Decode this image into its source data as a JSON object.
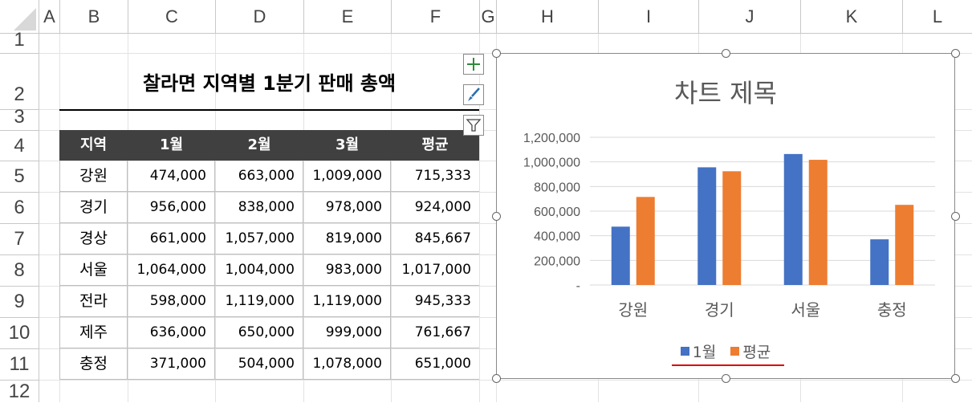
{
  "columns": [
    "A",
    "B",
    "C",
    "D",
    "E",
    "F",
    "G",
    "H",
    "I",
    "J",
    "K",
    "L"
  ],
  "rows": [
    "1",
    "2",
    "3",
    "4",
    "5",
    "6",
    "7",
    "8",
    "9",
    "10",
    "11",
    "12"
  ],
  "table": {
    "title": "찰라면 지역별 1분기 판매 총액",
    "headers": [
      "지역",
      "1월",
      "2월",
      "3월",
      "평균"
    ],
    "body": [
      [
        "강원",
        "474,000",
        "663,000",
        "1,009,000",
        "715,333"
      ],
      [
        "경기",
        "956,000",
        "838,000",
        "978,000",
        "924,000"
      ],
      [
        "경상",
        "661,000",
        "1,057,000",
        "819,000",
        "845,667"
      ],
      [
        "서울",
        "1,064,000",
        "1,004,000",
        "983,000",
        "1,017,000"
      ],
      [
        "전라",
        "598,000",
        "1,119,000",
        "1,119,000",
        "945,333"
      ],
      [
        "제주",
        "636,000",
        "650,000",
        "999,000",
        "761,667"
      ],
      [
        "충정",
        "371,000",
        "504,000",
        "1,078,000",
        "651,000"
      ]
    ]
  },
  "chart_buttons": [
    {
      "icon": "plus-icon",
      "name": "chart-elements-button"
    },
    {
      "icon": "brush-icon",
      "name": "chart-styles-button"
    },
    {
      "icon": "filter-icon",
      "name": "chart-filters-button"
    }
  ],
  "chart_data": {
    "type": "bar",
    "title": "차트 제목",
    "categories": [
      "강원",
      "경기",
      "서울",
      "충정"
    ],
    "series": [
      {
        "name": "1월",
        "values": [
          474000,
          956000,
          1064000,
          371000
        ],
        "color": "#4472c4"
      },
      {
        "name": "평균",
        "values": [
          715333,
          924000,
          1017000,
          651000
        ],
        "color": "#ed7d31"
      }
    ],
    "ylim": [
      0,
      1200000
    ],
    "yticks": [
      "-",
      "200,000",
      "400,000",
      "600,000",
      "800,000",
      "1,000,000",
      "1,200,000"
    ],
    "grid": true,
    "legend": "bottom"
  }
}
